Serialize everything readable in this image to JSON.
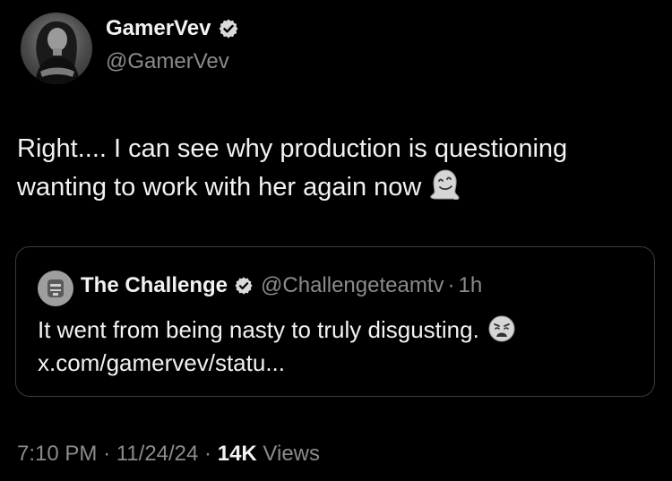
{
  "author": {
    "display_name": "GamerVev",
    "handle": "@GamerVev"
  },
  "tweet": {
    "text": "Right.... I can see why production is questioning wanting to work with her again now",
    "emoji": "melting-face-emoji"
  },
  "quoted_tweet": {
    "display_name": "The Challenge",
    "handle": "@Challengeteamtv",
    "separator": "·",
    "time": "1h",
    "text": "It went from being nasty to truly disgusting.",
    "emoji": "weary-face-emoji",
    "link": "x.com/gamervev/statu..."
  },
  "meta": {
    "time": "7:10 PM",
    "separator1": "·",
    "date": "11/24/24",
    "separator2": "·",
    "views_count": "14K",
    "views_label": "Views"
  },
  "colors": {
    "background": "#000000",
    "text": "#f2f2f2",
    "secondary_text": "#8b8b8b",
    "border": "#3a3a3a"
  }
}
